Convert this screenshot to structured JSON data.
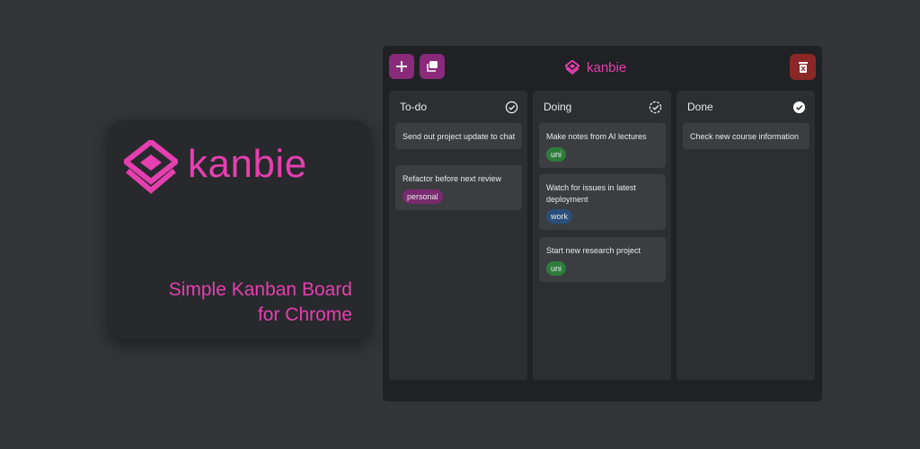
{
  "promo": {
    "brand": "kanbie",
    "tagline_line1": "Simple Kanban Board",
    "tagline_line2": "for Chrome",
    "brand_color": "#e53fb0",
    "logo_icon": "kanbie-logo-icon"
  },
  "app": {
    "title": "kanbie",
    "toolbar": {
      "add_icon": "plus-icon",
      "copy_icon": "copy-icon",
      "delete_icon": "trash-icon"
    },
    "columns": [
      {
        "title": "To-do",
        "icon": "check-circle-outline-icon",
        "cards": [
          {
            "text": "Send out project update to chat"
          },
          {
            "text": "Refactor before next review",
            "tag": "personal",
            "tag_color": "#7a2a6e"
          }
        ]
      },
      {
        "title": "Doing",
        "icon": "check-circle-dashed-icon",
        "cards": [
          {
            "text": "Make notes from AI lectures",
            "tag": "uni",
            "tag_color": "#2d7d3a"
          },
          {
            "text": "Watch for issues in latest deployment",
            "tag": "work",
            "tag_color": "#2a4f7a"
          },
          {
            "text": "Start new research project",
            "tag": "uni",
            "tag_color": "#2d7d3a"
          }
        ]
      },
      {
        "title": "Done",
        "icon": "check-circle-filled-icon",
        "cards": [
          {
            "text": "Check new course information"
          }
        ]
      }
    ]
  }
}
